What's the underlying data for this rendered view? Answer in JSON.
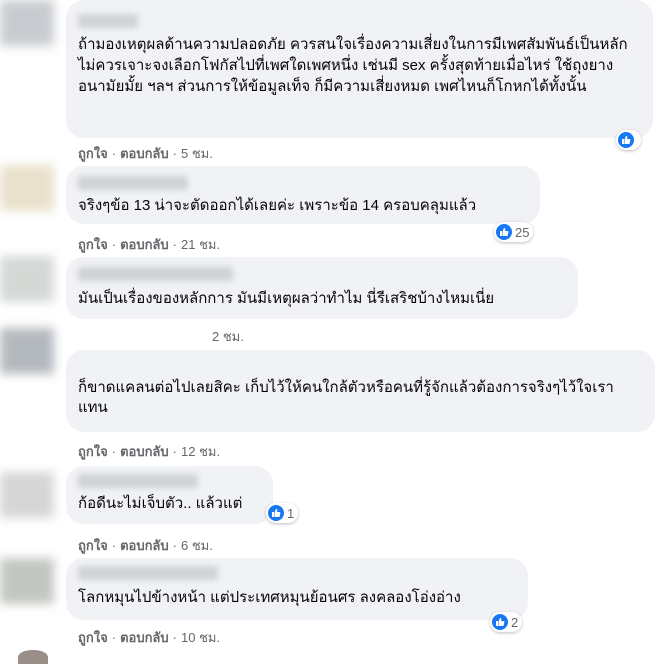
{
  "comments": [
    {
      "name": "",
      "text": "ถ้ามองเหตุผลด้านความปลอดภัย ควรสนใจเรื่องความเสี่ยงในการมีเพศสัมพันธ์เป็นหลัก ไม่ควรเจาะจงเลือกโฟกัสไปที่เพศใดเพศหนึ่ง เช่นมี sex ครั้งสุดท้ายเมื่อไหร่ ใช้ถุงยางอนามัยมั้ย ฯลฯ ส่วนการให้ข้อมูลเท็จ ก็มีความเสี่ยงหมด เพศไหนก็โกหกได้ทั้งนั้น",
      "like": "ถูกใจ",
      "reply": "ตอบกลับ",
      "time": "5 ชม.",
      "reactions": ""
    },
    {
      "name": "",
      "text": "จริงๆข้อ 13 น่าจะตัดออกได้เลยค่ะ เพราะข้อ 14 ครอบคลุมแล้ว",
      "like": "ถูกใจ",
      "reply": "ตอบกลับ",
      "time": "21 ชม.",
      "reactions": "25"
    },
    {
      "name": "",
      "text": "มันเป็นเรื่องของหลักการ มันมีเหตุผลว่าทำไม นี่รีเสริชบ้างไหมเนี่ย",
      "like": "",
      "reply": "",
      "time": "2 ชม.",
      "reactions": ""
    },
    {
      "name": "",
      "text": "ก็ขาดแคลนต่อไปเลยสิคะ เก็บไว้ให้คนใกล้ตัวหรือคนที่รู้จักแล้วต้องการจริงๆไว้ใจเราแทน",
      "like": "ถูกใจ",
      "reply": "ตอบกลับ",
      "time": "12 ชม.",
      "reactions": ""
    },
    {
      "name": "",
      "text": "ก้อดีนะไม่เจ็บตัว.. แล้วแต่",
      "like": "ถูกใจ",
      "reply": "ตอบกลับ",
      "time": "6 ชม.",
      "reactions": "1"
    },
    {
      "name": "",
      "text": "โลกหมุนไปข้างหน้า แต่ประเทศหมุนย้อนศร ลงคลองโอ่งอ่าง",
      "like": "ถูกใจ",
      "reply": "ตอบกลับ",
      "time": "10 ชม.",
      "reactions": "2"
    }
  ],
  "colors": {
    "bubble": "#f0f2f5",
    "meta": "#65676b",
    "like_blue": "#1877f2"
  }
}
